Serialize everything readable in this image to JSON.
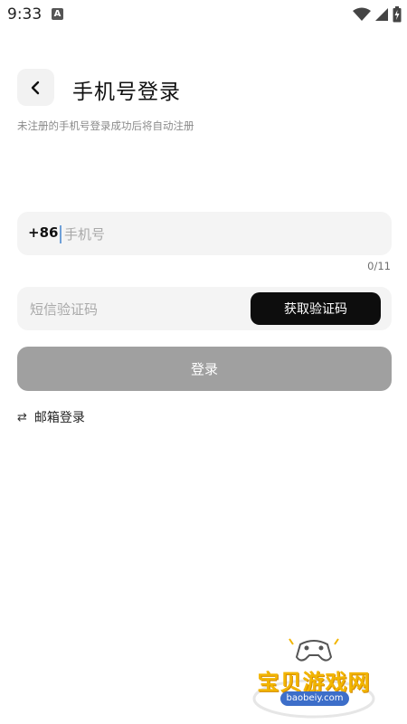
{
  "status_bar": {
    "time": "9:33",
    "notification_icon": "a-letter-icon"
  },
  "header": {
    "back_icon": "chevron-left-icon",
    "title": "手机号登录",
    "subtitle": "未注册的手机号登录成功后将自动注册"
  },
  "phone": {
    "country_code": "+86",
    "placeholder": "手机号",
    "value": "",
    "counter": "0/11"
  },
  "code": {
    "placeholder": "短信验证码",
    "value": "",
    "button_label": "获取验证码"
  },
  "login": {
    "button_label": "登录"
  },
  "alt_login": {
    "icon": "swap-arrows-icon",
    "label": "邮箱登录"
  },
  "watermark": {
    "text": "宝贝游戏网",
    "url": "baobeiy.com"
  },
  "colors": {
    "accent_dark": "#0d0d0d",
    "login_disabled": "#a0a0a0",
    "field_bg": "#f4f4f4",
    "watermark_gold": "#f2b500"
  }
}
